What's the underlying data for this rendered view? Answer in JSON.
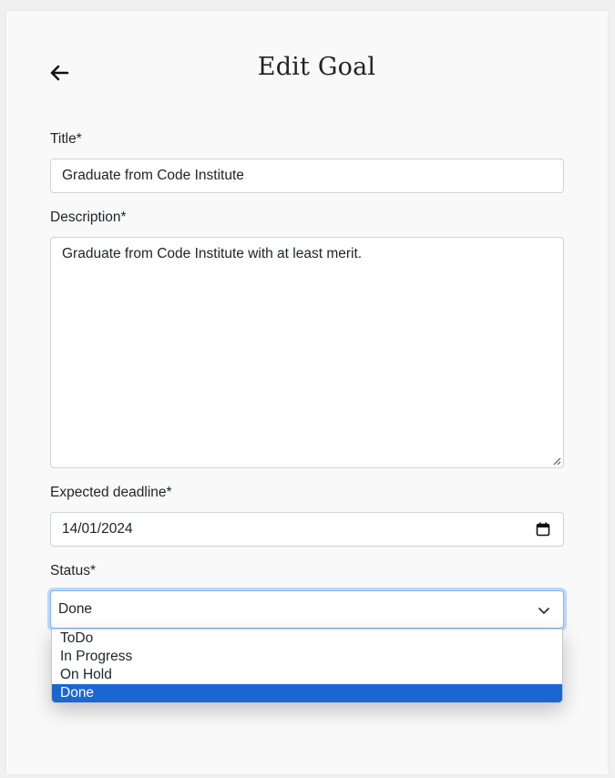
{
  "header": {
    "title": "Edit Goal",
    "back_icon": "arrow-left-icon"
  },
  "form": {
    "title_label": "Title*",
    "title_value": "Graduate from Code Institute",
    "description_label": "Description*",
    "description_value": "Graduate from Code Institute with at least merit.",
    "deadline_label": "Expected deadline*",
    "deadline_value": "14/01/2024",
    "deadline_icon": "calendar-icon",
    "status_label": "Status*",
    "status_value": "Done",
    "status_icon": "chevron-down-icon",
    "status_options": [
      {
        "label": "ToDo"
      },
      {
        "label": "In Progress"
      },
      {
        "label": "On Hold"
      },
      {
        "label": "Done",
        "selected": true
      }
    ]
  },
  "colors": {
    "selected_option": "#1a67d2",
    "focus_border": "#86b7fe",
    "card_background": "#f9f9f9"
  }
}
